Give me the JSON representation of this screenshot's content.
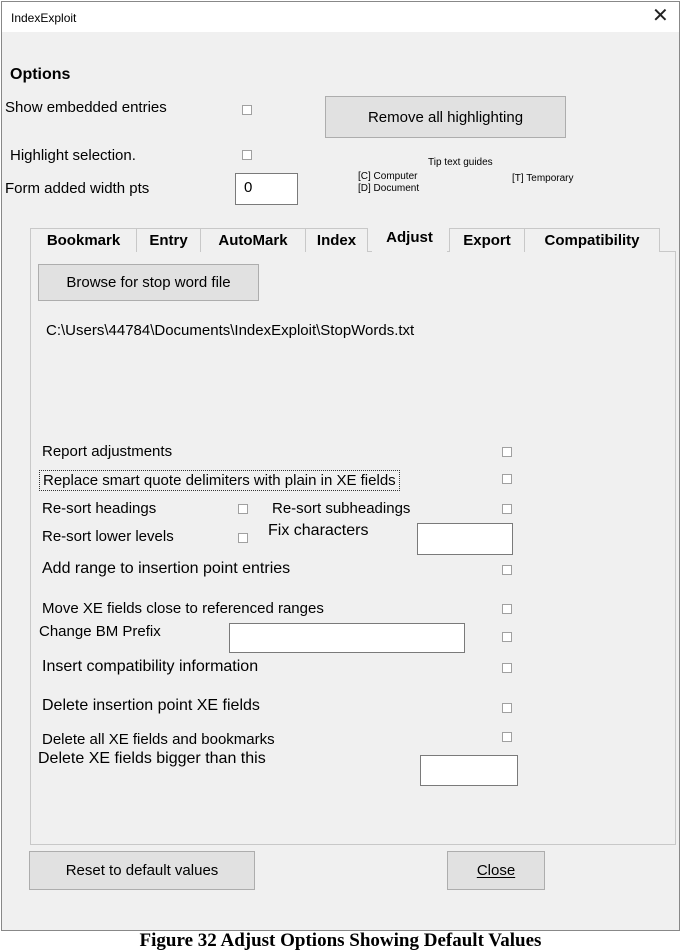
{
  "window": {
    "title": "IndexExploit",
    "close_glyph": "✕"
  },
  "options": {
    "heading": "Options",
    "show_embedded_label": "Show embedded entries",
    "highlight_label": "Highlight selection.",
    "width_label": "Form added width pts",
    "width_value": "0",
    "remove_highlight_button": "Remove all highlighting",
    "tip_heading": "Tip text guides",
    "tip_computer": "[C] Computer",
    "tip_document": "[D] Document",
    "tip_temporary": "[T] Temporary"
  },
  "tabs": [
    {
      "label": "Bookmark",
      "active": false
    },
    {
      "label": "Entry",
      "active": false
    },
    {
      "label": "AutoMark",
      "active": false
    },
    {
      "label": "Index",
      "active": false
    },
    {
      "label": "Adjust",
      "active": true
    },
    {
      "label": "Export",
      "active": false
    },
    {
      "label": "Compatibility",
      "active": false
    }
  ],
  "adjust": {
    "browse_button": "Browse for stop word file",
    "stop_word_path": "C:\\Users\\44784\\Documents\\IndexExploit\\StopWords.txt",
    "report_adjustments": "Report adjustments",
    "replace_smart_quotes": "Replace smart quote delimiters with plain in XE fields",
    "resort_headings": "Re-sort headings",
    "resort_subheadings": "Re-sort subheadings",
    "resort_lower": "Re-sort lower levels",
    "fix_characters": "Fix characters",
    "fix_characters_value": "",
    "add_range": "Add range to insertion point entries",
    "move_xe": "Move XE fields close to referenced ranges",
    "change_bm_prefix": "Change BM Prefix",
    "bm_prefix_value": "",
    "insert_compat": "Insert compatibility information",
    "delete_insertion": "Delete insertion point XE fields",
    "delete_all": "Delete all XE fields and bookmarks",
    "delete_bigger": "Delete XE fields bigger than this",
    "delete_bigger_value": ""
  },
  "footer": {
    "reset_button": "Reset to default values",
    "close_button": "Close"
  },
  "caption": "Figure 32 Adjust Options Showing Default Values"
}
